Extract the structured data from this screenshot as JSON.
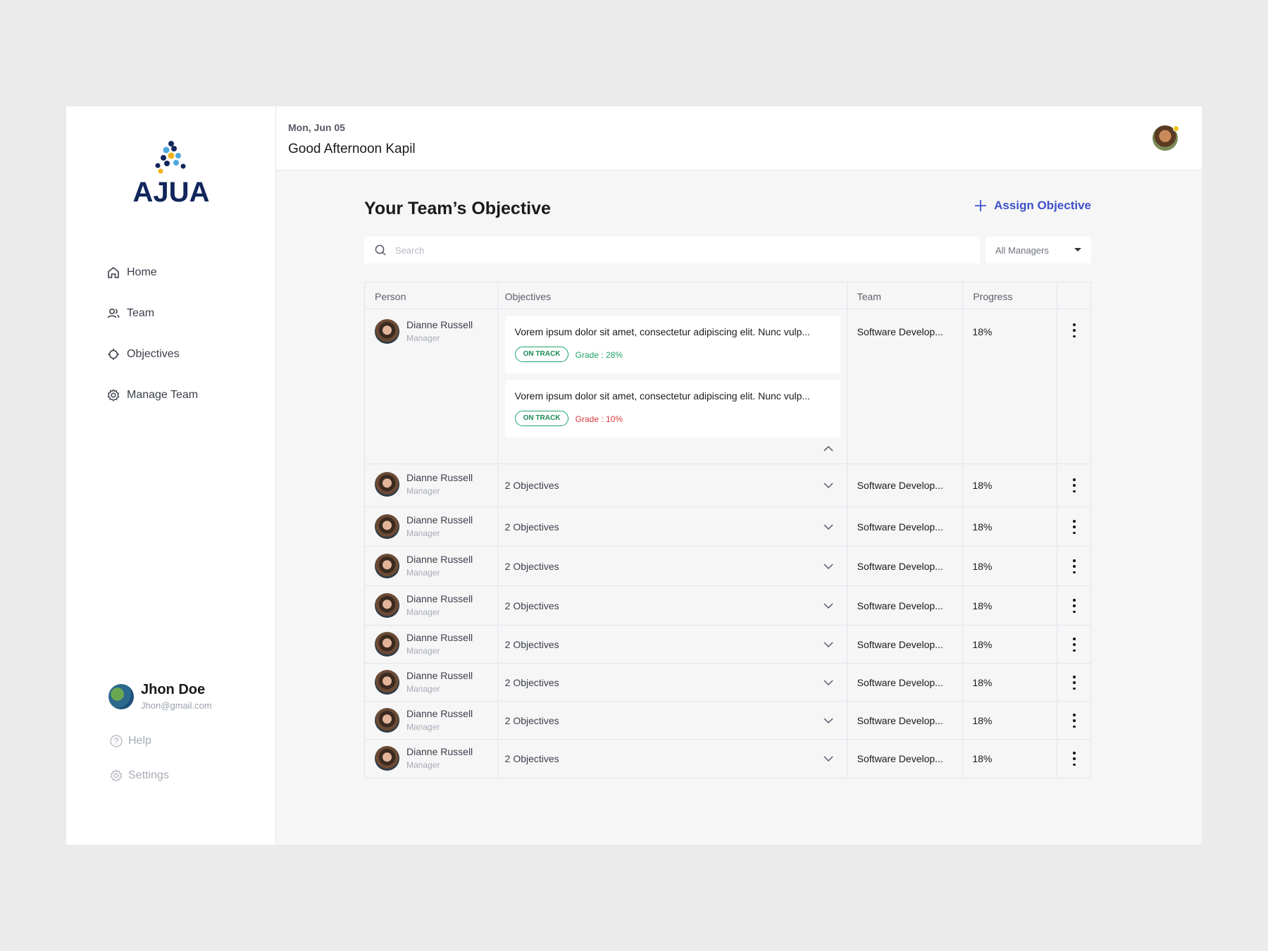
{
  "brand": {
    "name": "AJUA"
  },
  "sidebar": {
    "nav": [
      {
        "label": "Home",
        "icon": "home-icon"
      },
      {
        "label": "Team",
        "icon": "users-icon"
      },
      {
        "label": "Objectives",
        "icon": "target-icon"
      },
      {
        "label": "Manage Team",
        "icon": "gear-icon"
      }
    ],
    "user": {
      "name": "Jhon Doe",
      "email": "Jhon@gmail.com"
    },
    "footer": [
      {
        "label": "Help",
        "icon": "help-icon"
      },
      {
        "label": "Settings",
        "icon": "settings-icon"
      }
    ]
  },
  "header": {
    "date": "Mon, Jun 05",
    "greeting": "Good Afternoon Kapil"
  },
  "main": {
    "title": "Your Team’s Objective",
    "assign_label": "Assign Objective",
    "search_placeholder": "Search",
    "filter_label": "All Managers",
    "columns": [
      "Person",
      "Objectives",
      "Team",
      "Progress"
    ],
    "expanded_row": {
      "name": "Dianne Russell",
      "role": "Manager",
      "team": "Software Develop...",
      "progress": "18%",
      "objectives": [
        {
          "text": "Vorem ipsum dolor sit amet, consectetur adipiscing elit. Nunc vulp...",
          "status": "ON TRACK",
          "grade": "Grade : 28%",
          "grade_color": "#1fa36a"
        },
        {
          "text": "Vorem ipsum dolor sit amet, consectetur adipiscing elit. Nunc vulp...",
          "status": "ON TRACK",
          "grade": "Grade : 10%",
          "grade_color": "#d63b3b"
        }
      ]
    },
    "rows": [
      {
        "name": "Dianne Russell",
        "role": "Manager",
        "objectives": "2 Objectives",
        "team": "Software Develop...",
        "progress": "18%"
      },
      {
        "name": "Dianne Russell",
        "role": "Manager",
        "objectives": "2 Objectives",
        "team": "Software Develop...",
        "progress": "18%"
      },
      {
        "name": "Dianne Russell",
        "role": "Manager",
        "objectives": "2 Objectives",
        "team": "Software Develop...",
        "progress": "18%"
      },
      {
        "name": "Dianne Russell",
        "role": "Manager",
        "objectives": "2 Objectives",
        "team": "Software Develop...",
        "progress": "18%"
      },
      {
        "name": "Dianne Russell",
        "role": "Manager",
        "objectives": "2 Objectives",
        "team": "Software Develop...",
        "progress": "18%"
      },
      {
        "name": "Dianne Russell",
        "role": "Manager",
        "objectives": "2 Objectives",
        "team": "Software Develop...",
        "progress": "18%"
      },
      {
        "name": "Dianne Russell",
        "role": "Manager",
        "objectives": "2 Objectives",
        "team": "Software Develop...",
        "progress": "18%"
      },
      {
        "name": "Dianne Russell",
        "role": "Manager",
        "objectives": "2 Objectives",
        "team": "Software Develop...",
        "progress": "18%"
      }
    ]
  },
  "colors": {
    "accent": "#3f51c8",
    "brand": "#12265c",
    "on_track": "#1fa36a"
  }
}
